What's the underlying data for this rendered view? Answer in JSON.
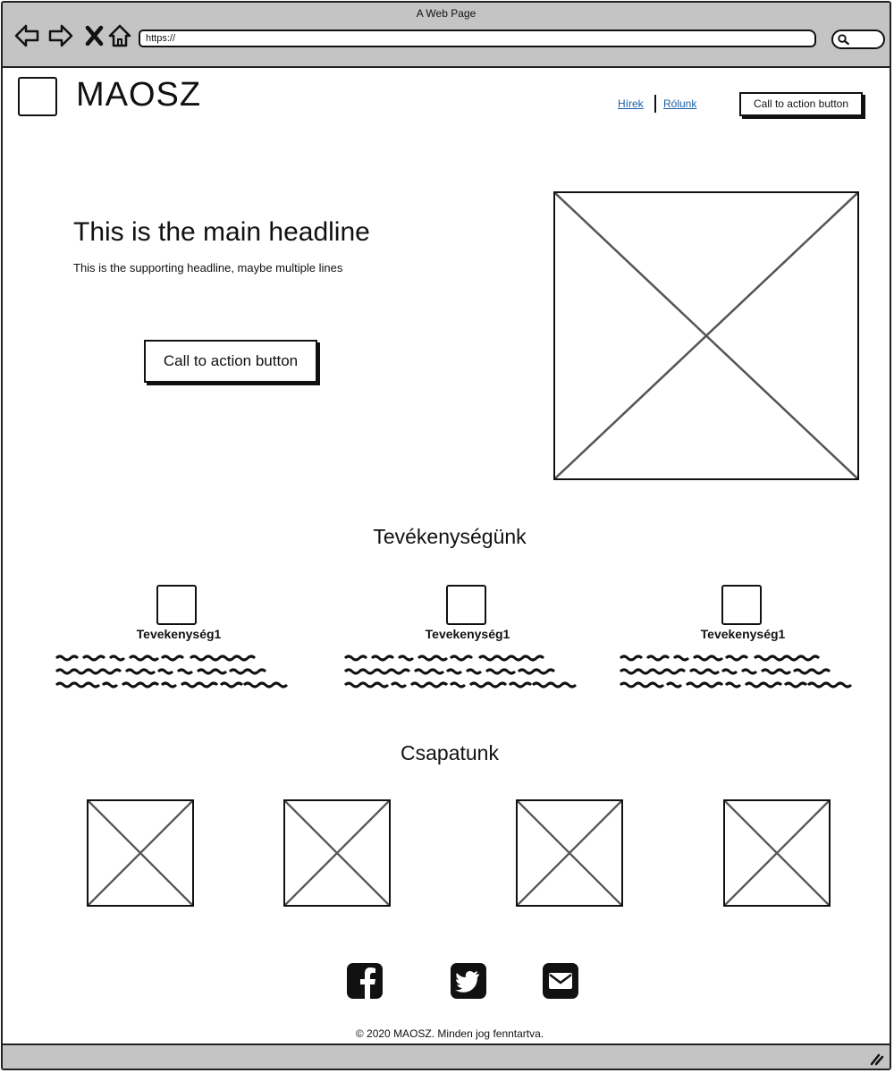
{
  "browser": {
    "window_title": "A Web Page",
    "url": "https://"
  },
  "header": {
    "brand": "MAOSZ",
    "nav": [
      "Hírek",
      "Rólunk"
    ],
    "cta_label": "Call to action button"
  },
  "hero": {
    "headline": "This is the main headline",
    "subheadline": "This is the supporting headline, maybe multiple lines",
    "cta_label": "Call to action button"
  },
  "activities": {
    "title": "Tevékenységünk",
    "items": [
      {
        "title": "Tevekenység1"
      },
      {
        "title": "Tevekenység1"
      },
      {
        "title": "Tevekenység1"
      }
    ]
  },
  "team": {
    "title": "Csapatunk",
    "member_count": 4
  },
  "footer": {
    "social_icons": [
      "facebook-icon",
      "twitter-icon",
      "email-icon"
    ],
    "copyright": "© 2020 MAOSZ. Minden jog fenntartva."
  },
  "colors": {
    "chrome": "#c4c4c4",
    "link": "#1a5fa8",
    "ink": "#111111",
    "placeholder_x": "#555555"
  }
}
